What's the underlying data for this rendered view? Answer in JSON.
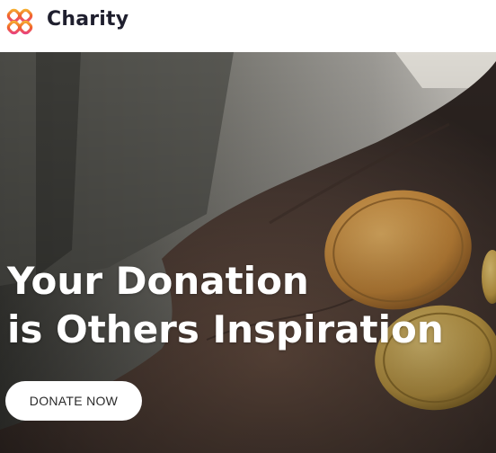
{
  "header": {
    "brand": "Charity",
    "logo_icon": "interlocking-hearts-logo-icon"
  },
  "hero": {
    "headline_line1": "Your Donation",
    "headline_line2": "is Others Inspiration",
    "cta_label": "DONATE NOW",
    "image": "photo-hand-holding-euro-coins"
  },
  "colors": {
    "logo_gradient": [
      "#f59e42",
      "#e8457a"
    ],
    "brand_text": "#1f1f2e",
    "cta_bg": "#ffffff"
  }
}
